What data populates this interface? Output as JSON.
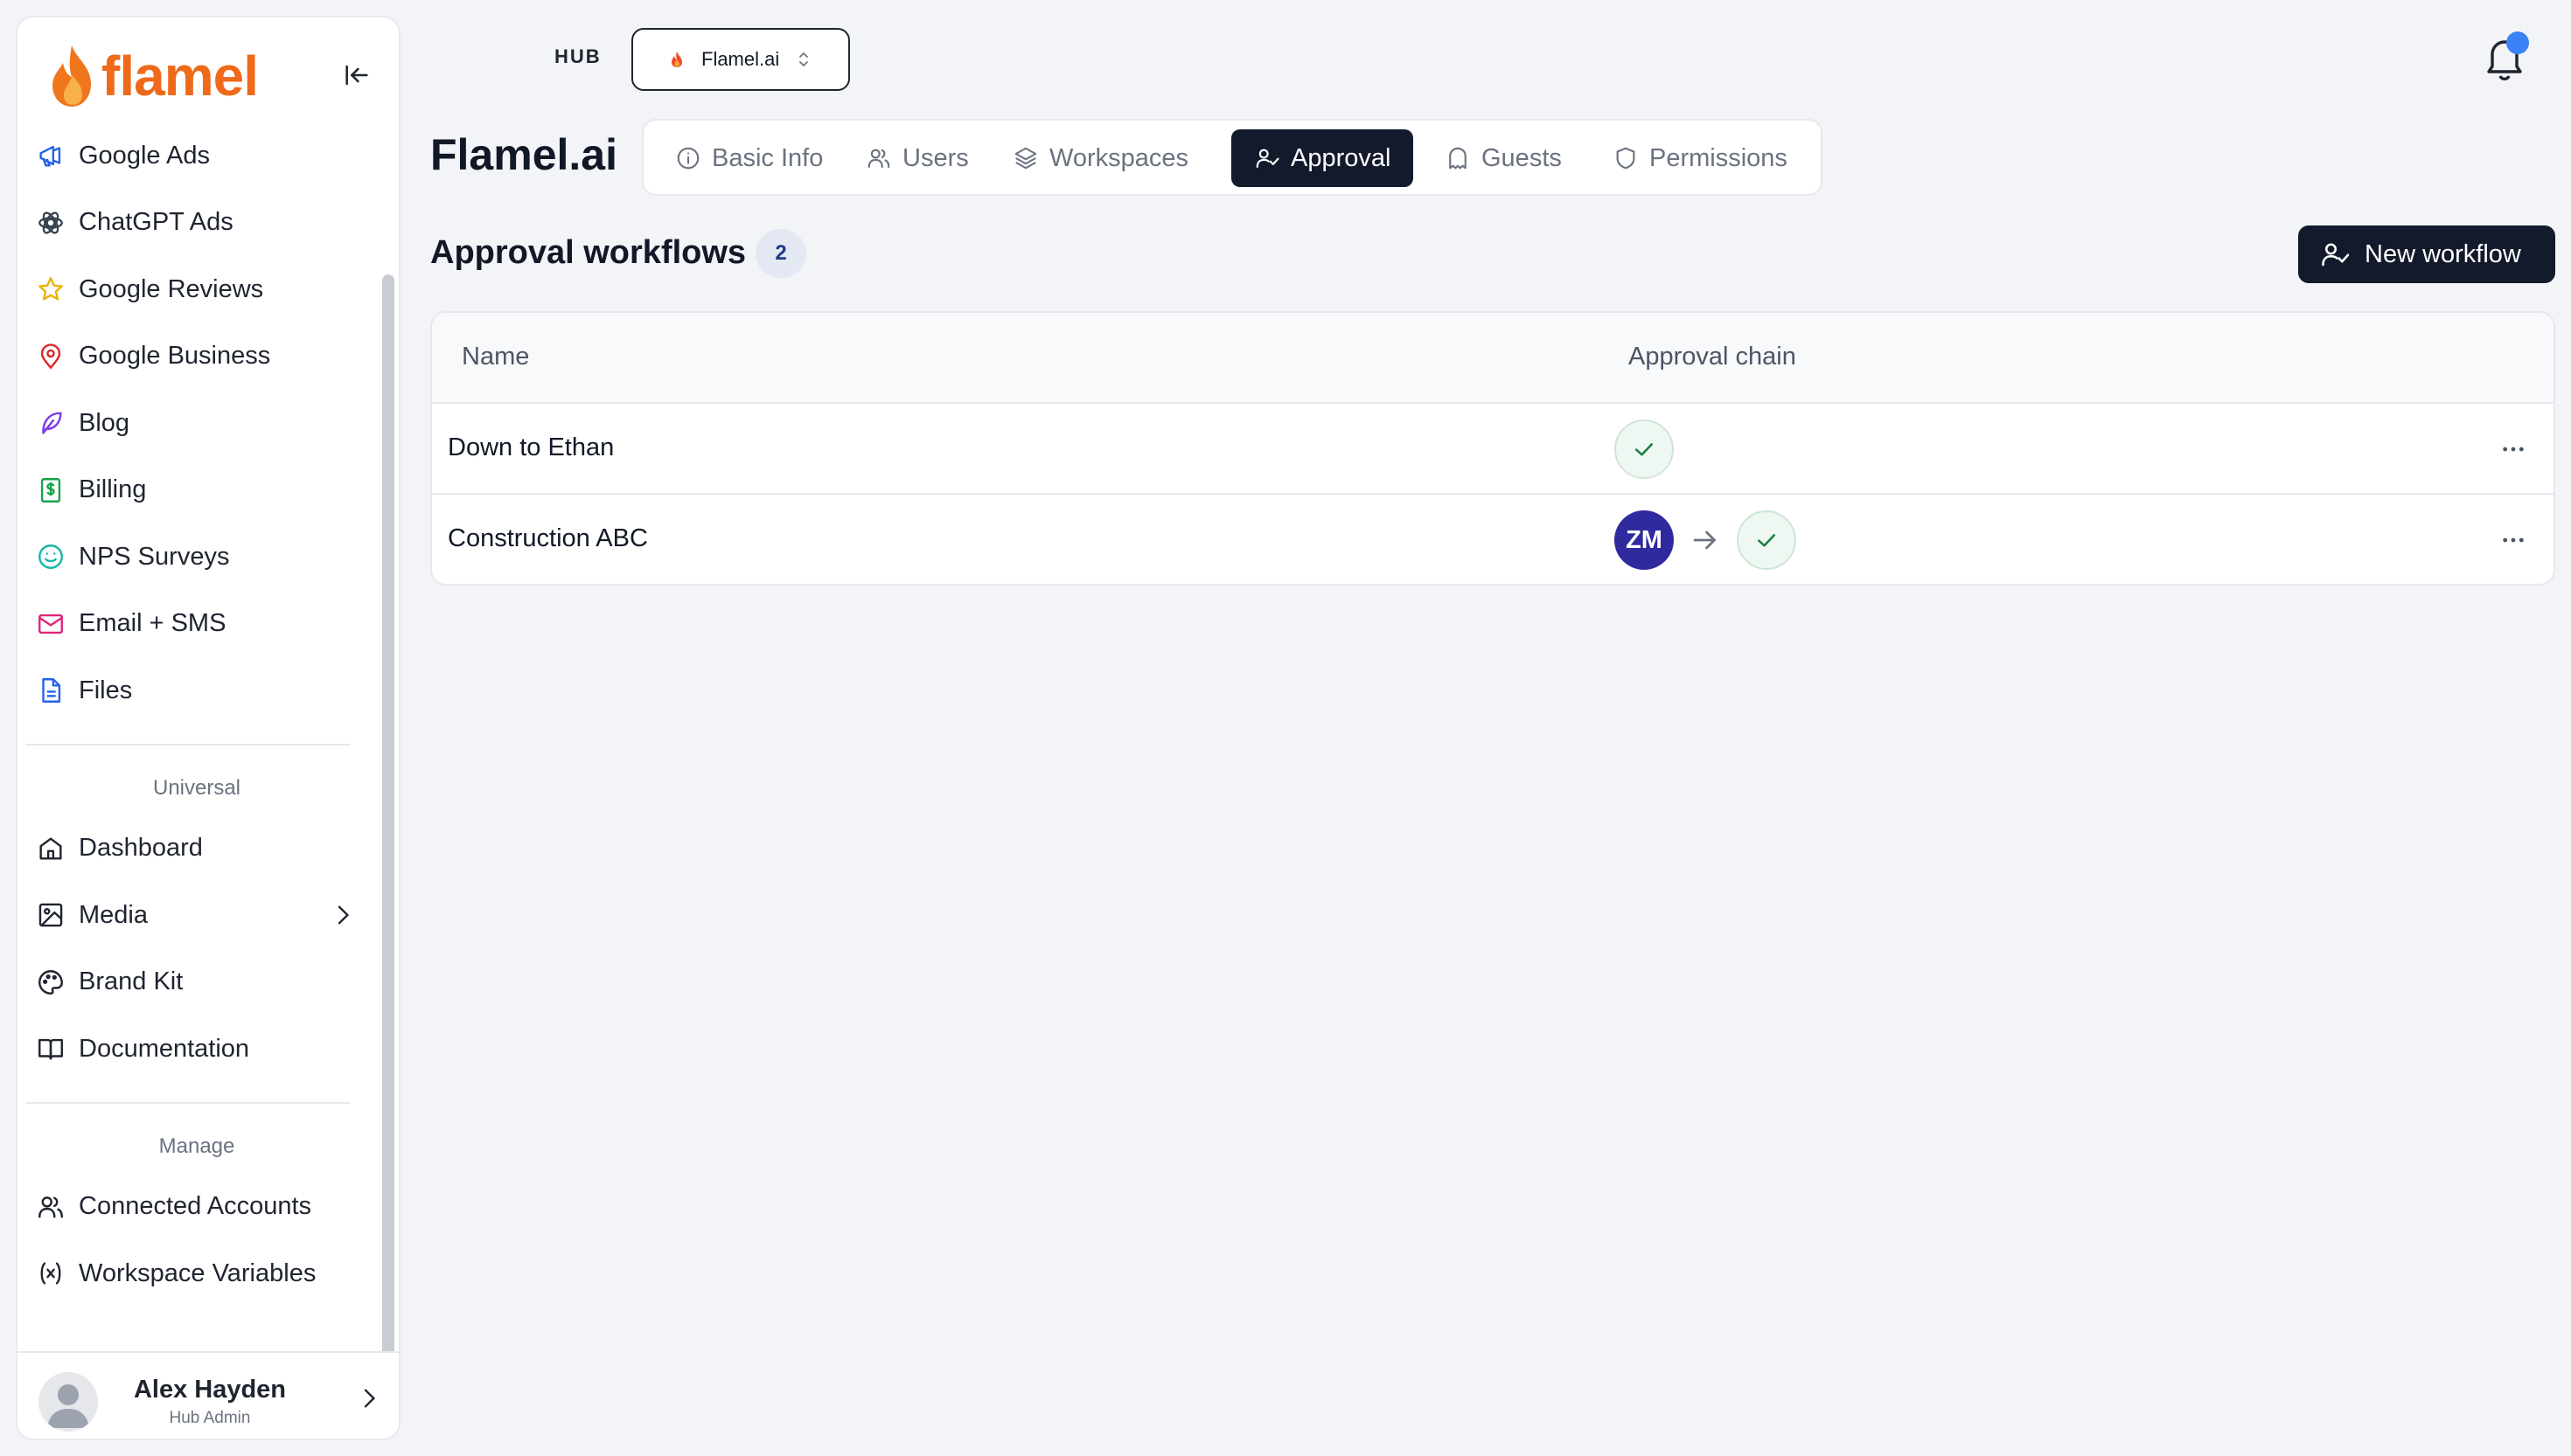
{
  "brand": {
    "name": "flamel",
    "accent": "#ee6a1a"
  },
  "sidebar": {
    "items": [
      {
        "label": "Google Ads",
        "icon": "megaphone-icon"
      },
      {
        "label": "ChatGPT Ads",
        "icon": "openai-icon"
      },
      {
        "label": "Google Reviews",
        "icon": "star-icon"
      },
      {
        "label": "Google Business",
        "icon": "map-pin-icon"
      },
      {
        "label": "Blog",
        "icon": "feather-icon"
      },
      {
        "label": "Billing",
        "icon": "dollar-file-icon"
      },
      {
        "label": "NPS Surveys",
        "icon": "smile-icon"
      },
      {
        "label": "Email + SMS",
        "icon": "mail-icon"
      },
      {
        "label": "Files",
        "icon": "file-icon"
      }
    ],
    "universal_title": "Universal",
    "universal_items": [
      {
        "label": "Dashboard",
        "icon": "home-icon"
      },
      {
        "label": "Media",
        "icon": "image-icon"
      },
      {
        "label": "Brand Kit",
        "icon": "palette-icon"
      },
      {
        "label": "Documentation",
        "icon": "book-icon"
      }
    ],
    "manage_title": "Manage",
    "manage_items": [
      {
        "label": "Connected Accounts",
        "icon": "users-icon"
      },
      {
        "label": "Workspace Variables",
        "icon": "variable-icon"
      }
    ],
    "user": {
      "name": "Alex Hayden",
      "role": "Hub Admin"
    }
  },
  "header": {
    "hub_label": "HUB",
    "hub_selector": "Flamel.ai",
    "notification_dot_color": "#3b82f6"
  },
  "page": {
    "title": "Flamel.ai",
    "tabs": [
      {
        "label": "Basic Info",
        "icon": "info-icon"
      },
      {
        "label": "Users",
        "icon": "users-icon"
      },
      {
        "label": "Workspaces",
        "icon": "layers-icon"
      },
      {
        "label": "Approval",
        "icon": "user-check-icon",
        "active": true
      },
      {
        "label": "Guests",
        "icon": "ghost-icon"
      },
      {
        "label": "Permissions",
        "icon": "shield-icon"
      }
    ],
    "section_title": "Approval workflows",
    "count": "2",
    "new_button": "New workflow",
    "table": {
      "columns": [
        "Name",
        "Approval chain"
      ],
      "rows": [
        {
          "name": "Down to Ethan",
          "approvers": []
        },
        {
          "name": "Construction ABC",
          "approvers": [
            "ZM"
          ]
        }
      ]
    }
  }
}
